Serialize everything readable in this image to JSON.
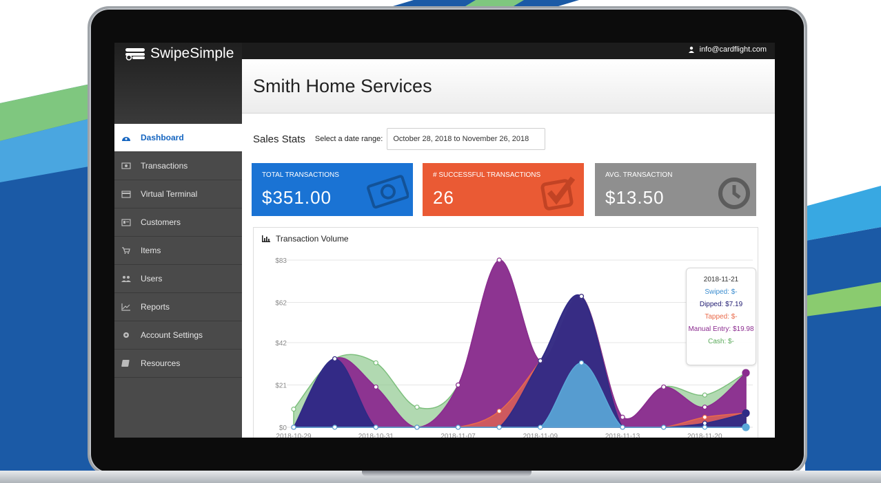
{
  "app": {
    "name": "SwipeSimple",
    "user_email": "info@cardflight.com"
  },
  "sidebar": {
    "items": [
      {
        "label": "Dashboard",
        "icon": "dashboard-icon",
        "active": true
      },
      {
        "label": "Transactions",
        "icon": "transactions-icon"
      },
      {
        "label": "Virtual Terminal",
        "icon": "credit-card-icon"
      },
      {
        "label": "Customers",
        "icon": "id-card-icon"
      },
      {
        "label": "Items",
        "icon": "cart-icon"
      },
      {
        "label": "Users",
        "icon": "users-icon"
      },
      {
        "label": "Reports",
        "icon": "line-chart-icon"
      },
      {
        "label": "Account Settings",
        "icon": "gear-icon"
      },
      {
        "label": "Resources",
        "icon": "book-icon"
      }
    ]
  },
  "page": {
    "title": "Smith Home Services",
    "stats_title": "Sales Stats",
    "range_label": "Select a date range:",
    "range_value": "October 28, 2018 to November 26, 2018"
  },
  "cards": [
    {
      "label": "TOTAL TRANSACTIONS",
      "value": "$351.00",
      "color": "#1a73d4",
      "icon": "money-icon"
    },
    {
      "label": "# SUCCESSFUL TRANSACTIONS",
      "value": "26",
      "color": "#ea5a34",
      "icon": "checkbox-icon"
    },
    {
      "label": "AVG. TRANSACTION",
      "value": "$13.50",
      "color": "#8f8f8f",
      "icon": "clock-icon"
    }
  ],
  "chart_panel": {
    "title": "Transaction Volume"
  },
  "chart_data": {
    "type": "area",
    "title": "Transaction Volume",
    "x": [
      "2018-10-29",
      "2018-10-30",
      "2018-10-31",
      "2018-11-01",
      "2018-11-07",
      "2018-11-08",
      "2018-11-09",
      "2018-11-10",
      "2018-11-13",
      "2018-11-14",
      "2018-11-20",
      "2018-11-21"
    ],
    "x_tick_labels": [
      "2018-10-29",
      "2018-10-31",
      "2018-11-07",
      "2018-11-09",
      "2018-11-13",
      "2018-11-20"
    ],
    "y_ticks": [
      "$0",
      "$21",
      "$42",
      "$62",
      "$83"
    ],
    "ylim": [
      0,
      83
    ],
    "grid": true,
    "series": [
      {
        "name": "Cash",
        "color": "#7dbf7d",
        "values": [
          9,
          34,
          32,
          10,
          21,
          83,
          33,
          65,
          5,
          20,
          16,
          27
        ]
      },
      {
        "name": "Manual Entry",
        "color": "#8b2b8f",
        "values": [
          0,
          34,
          20,
          0,
          21,
          83,
          33,
          65,
          5,
          20,
          10,
          27
        ]
      },
      {
        "name": "Tapped",
        "color": "#ea6a4a",
        "values": [
          0,
          0,
          0,
          0,
          0,
          8,
          33,
          65,
          0,
          0,
          5,
          7
        ]
      },
      {
        "name": "Dipped",
        "color": "#2e2a86",
        "values": [
          0,
          34,
          0,
          0,
          0,
          0,
          33,
          65,
          0,
          0,
          2,
          7
        ]
      },
      {
        "name": "Swiped",
        "color": "#5aa8d8",
        "values": [
          0,
          0,
          0,
          0,
          0,
          0,
          0,
          32,
          0,
          0,
          0,
          0
        ]
      }
    ]
  },
  "tooltip": {
    "date": "2018-11-21",
    "swiped": "Swiped: $-",
    "dipped": "Dipped: $7.19",
    "tapped": "Tapped: $-",
    "manual": "Manual Entry: $19.98",
    "cash": "Cash: $-"
  }
}
